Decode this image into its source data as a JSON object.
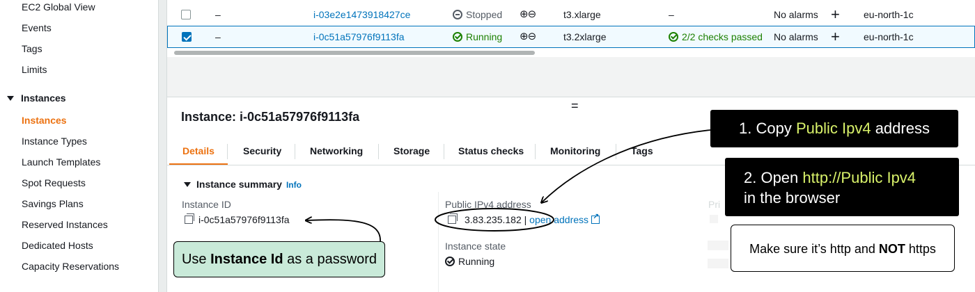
{
  "sidebar": {
    "items_top": [
      "EC2 Global View",
      "Events",
      "Tags",
      "Limits"
    ],
    "group_label": "Instances",
    "group_items": [
      "Instances",
      "Instance Types",
      "Launch Templates",
      "Spot Requests",
      "Savings Plans",
      "Reserved Instances",
      "Dedicated Hosts",
      "Capacity Reservations"
    ],
    "active_item": "Instances"
  },
  "table": {
    "rows": [
      {
        "name": "–",
        "id": "i-03e2e1473918427ce",
        "state": "Stopped",
        "type": "t3.xlarge",
        "checks": "–",
        "alarms": "No alarms",
        "az": "eu-north-1c",
        "selected": false
      },
      {
        "name": "–",
        "id": "i-0c51a57976f9113fa",
        "state": "Running",
        "type": "t3.2xlarge",
        "checks": "2/2 checks passed",
        "alarms": "No alarms",
        "az": "eu-north-1c",
        "selected": true
      }
    ],
    "add_symbol": "+",
    "zoom_symbols": "⊕⊖"
  },
  "details": {
    "drag_handle": "=",
    "title": "Instance: i-0c51a57976f9113fa",
    "tabs": [
      "Details",
      "Security",
      "Networking",
      "Storage",
      "Status checks",
      "Monitoring",
      "Tags"
    ],
    "active_tab": "Details",
    "summary_label": "Instance summary",
    "info_label": "Info",
    "instance_id_label": "Instance ID",
    "instance_id_value": "i-0c51a57976f9113fa",
    "public_ip_label": "Public IPv4 address",
    "public_ip_value": "3.83.235.182",
    "separator": "|",
    "open_address_label": "open address",
    "instance_state_label": "Instance state",
    "instance_state_value": "Running",
    "faded_label": "Pri"
  },
  "annotations": {
    "step1_prefix": "1. Copy ",
    "step1_highlight": "Public Ipv4",
    "step1_suffix": " address",
    "step2_prefix": "2. Open ",
    "step2_highlight": "http://Public Ipv4",
    "step2_line2": "in the browser",
    "note_prefix": "Make sure it’s http and ",
    "note_bold": "NOT",
    "note_suffix": " https",
    "password_prefix": "Use ",
    "password_bold": "Instance Id",
    "password_suffix": " as a password",
    "highlight_color": "#d9f26a",
    "green_box_color": "#c9ead9"
  },
  "colors": {
    "accent_orange": "#ec7211",
    "link_blue": "#0073bb",
    "success_green": "#1d8102"
  }
}
